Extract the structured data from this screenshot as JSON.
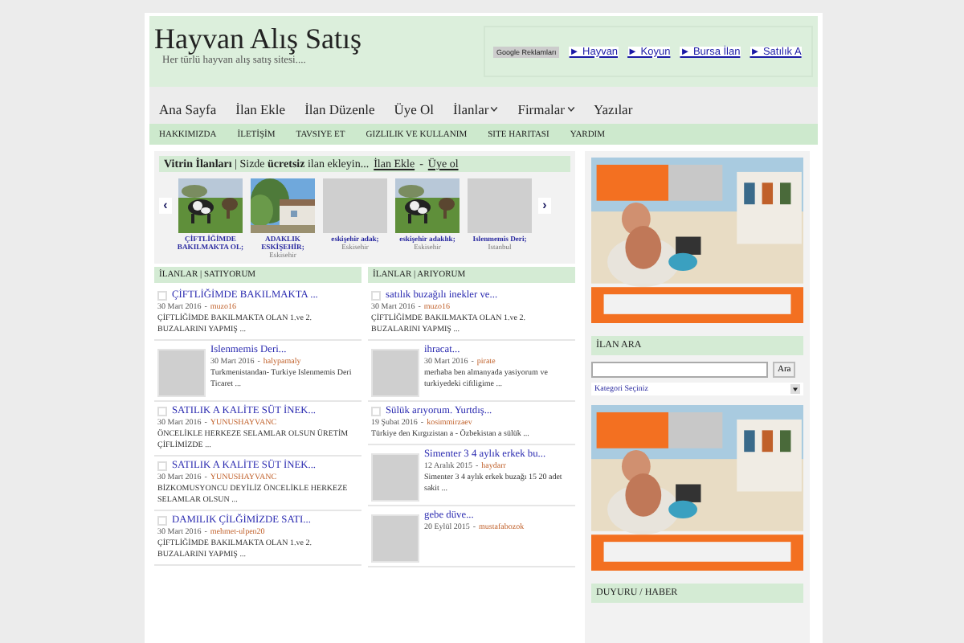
{
  "site": {
    "title": "Hayvan Alış Satış",
    "tagline": "Her türlü hayvan alış satış sitesi....",
    "ad_label": "Google Reklamları",
    "ad_links": [
      "► Hayvan",
      "► Koyun",
      "► Bursa İlan",
      "► Satılık A"
    ]
  },
  "nav": [
    {
      "label": "Ana Sayfa",
      "dropdown": false
    },
    {
      "label": "İlan Ekle",
      "dropdown": false
    },
    {
      "label": "İlan Düzenle",
      "dropdown": false
    },
    {
      "label": "Üye Ol",
      "dropdown": false
    },
    {
      "label": "İlanlar",
      "dropdown": true
    },
    {
      "label": "Firmalar",
      "dropdown": true
    },
    {
      "label": "Yazılar",
      "dropdown": false
    }
  ],
  "subnav": [
    "HAKKIMIZDA",
    "İLETİŞİM",
    "TAVSIYE ET",
    "GIZLILIK VE KULLANIM",
    "SITE HARITASI",
    "YARDIM"
  ],
  "showcase": {
    "intro": "**Vitrin İlanları** | Sizde **ücretsiz** ilan ekleyin...",
    "links": [
      "İlan Ekle",
      "Üye ol"
    ],
    "separator": "-",
    "prev": "‹",
    "next": "›",
    "items": [
      {
        "kind": "picture",
        "title": "ÇİFTLİĞİMDE BAKILMAKTA OL;"
      },
      {
        "kind": "picture",
        "title": "ADAKLIK ESKİŞEHİR;",
        "city": "Eskisehir"
      },
      {
        "kind": "placeholder",
        "title": "eskişehir adak;",
        "city": "Eskisehir"
      },
      {
        "kind": "picture",
        "title": "eskişehir adaklık;",
        "city": "Eskisehir"
      },
      {
        "kind": "placeholder",
        "title": "Islenmemis Deri;",
        "city": "Istanbul"
      }
    ]
  },
  "listings": [
    {
      "heading": "İLANLAR | SATIYORUM",
      "items": [
        {
          "kind": "text",
          "title": "ÇİFTLİĞİMDE BAKILMAKTA ...",
          "date": "30 Mart 2016",
          "separator": "-",
          "author": "muzo16",
          "excerpt": "ÇİFTLİĞİMDE BAKILMAKTA OLAN 1.ve 2. BUZALARINI YAPMIŞ ..."
        },
        {
          "kind": "thumb",
          "title": "Islenmemis Deri...",
          "date": "30 Mart 2016",
          "separator": "-",
          "author": "halypamaly",
          "excerpt": "Turkmenistandan- Turkiye Islenmemis Deri Ticaret ..."
        },
        {
          "kind": "text",
          "title": "SATILIK A KALİTE SÜT İNEK...",
          "date": "30 Mart 2016",
          "separator": "-",
          "author": "YUNUSHAYVANC",
          "excerpt": "ÖNCELİKLE HERKEZE SELAMLAR OLSUN ÜRETİM ÇİFLİMİZDE ..."
        },
        {
          "kind": "text",
          "title": "SATILIK A KALİTE SÜT İNEK...",
          "date": "30 Mart 2016",
          "separator": "-",
          "author": "YUNUSHAYVANC",
          "excerpt": "BİZKOMUSYONCU DEYİLİZ ÖNCELİKLE HERKEZE SELAMLAR OLSUN ..."
        },
        {
          "kind": "text",
          "title": "DAMILIK ÇİLĞİMİZDE SATI...",
          "date": "30 Mart 2016",
          "separator": "-",
          "author": "mehmet-ulpen20",
          "excerpt": "ÇİFTLİĞİMDE BAKILMAKTA OLAN 1.ve 2. BUZALARINI YAPMIŞ ..."
        }
      ]
    },
    {
      "heading": "İLANLAR | ARIYORUM",
      "items": [
        {
          "kind": "text",
          "title": "satılık buzağılı inekler ve...",
          "date": "30 Mart 2016",
          "separator": "-",
          "author": "muzo16",
          "excerpt": "ÇİFTLİĞİMDE BAKILMAKTA OLAN 1.ve 2. BUZALARINI YAPMIŞ ..."
        },
        {
          "kind": "thumb",
          "title": "ihracat...",
          "date": "30 Mart 2016",
          "separator": "-",
          "author": "pirate",
          "excerpt": "merhaba ben almanyada yasiyorum ve turkiyedeki ciftligime ..."
        },
        {
          "kind": "text",
          "title": "Sülük arıyorum. Yurtdış...",
          "date": "19 Şubat 2016",
          "separator": "-",
          "author": "kosimmirzaev",
          "excerpt": "Türkiye den Kırgızistan a - Özbekistan a sülük ..."
        },
        {
          "kind": "thumb",
          "title": "Simenter 3 4 aylık erkek bu...",
          "date": "12 Aralık 2015",
          "separator": "-",
          "author": "haydarr",
          "excerpt": "Simenter 3 4 aylık erkek buzağı 15 20 adet sakit ..."
        },
        {
          "kind": "thumb",
          "title": "gebe düve...",
          "date": "20 Eylül 2015",
          "separator": "-",
          "author": "mustafabozok"
        }
      ]
    }
  ],
  "sidebar": {
    "search_heading": "İLAN ARA",
    "search_button": "Ara",
    "category": "Kategori Seçiniz",
    "news_heading": "DUYURU / HABER"
  }
}
